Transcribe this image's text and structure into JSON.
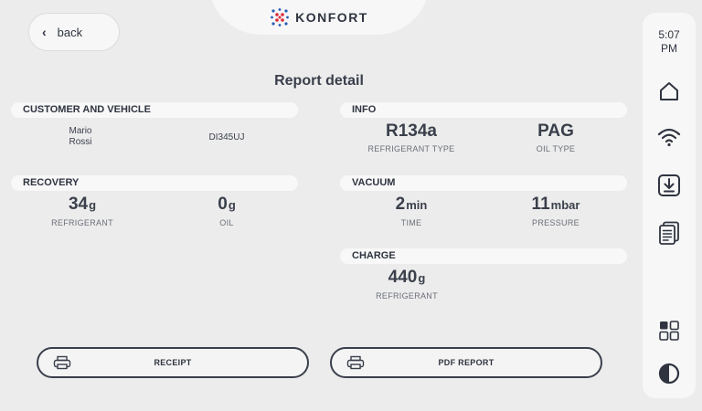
{
  "header": {
    "brand": "KONFORT",
    "back_label": "back"
  },
  "page_title": "Report detail",
  "customer": {
    "section_label": "CUSTOMER AND VEHICLE",
    "first_name": "Mario",
    "last_name": "Rossi",
    "plate": "DI345UJ"
  },
  "info": {
    "section_label": "INFO",
    "refrigerant_value": "R134a",
    "refrigerant_label": "REFRIGERANT TYPE",
    "oil_value": "PAG",
    "oil_label": "OIL TYPE"
  },
  "recovery": {
    "section_label": "RECOVERY",
    "refrigerant_value": "34",
    "refrigerant_unit": "g",
    "refrigerant_label": "REFRIGERANT",
    "oil_value": "0",
    "oil_unit": "g",
    "oil_label": "OIL"
  },
  "vacuum": {
    "section_label": "VACUUM",
    "time_value": "2",
    "time_unit": "min",
    "time_label": "TIME",
    "pressure_value": "11",
    "pressure_unit": "mbar",
    "pressure_label": "PRESSURE"
  },
  "charge": {
    "section_label": "CHARGE",
    "refrigerant_value": "440",
    "refrigerant_unit": "g",
    "refrigerant_label": "REFRIGERANT"
  },
  "actions": {
    "receipt_label": "RECEIPT",
    "pdf_label": "PDF REPORT"
  },
  "rail": {
    "time_line1": "5:07",
    "time_line2": "PM",
    "icons": [
      "home-icon",
      "wifi-icon",
      "download-icon",
      "documents-icon",
      "apps-grid-icon",
      "contrast-icon"
    ]
  },
  "colors": {
    "background": "#ececec",
    "panel": "#f7f7f7",
    "text": "#3a3f4b",
    "logo_red": "#d92b3a",
    "logo_blue": "#2a5db8"
  }
}
